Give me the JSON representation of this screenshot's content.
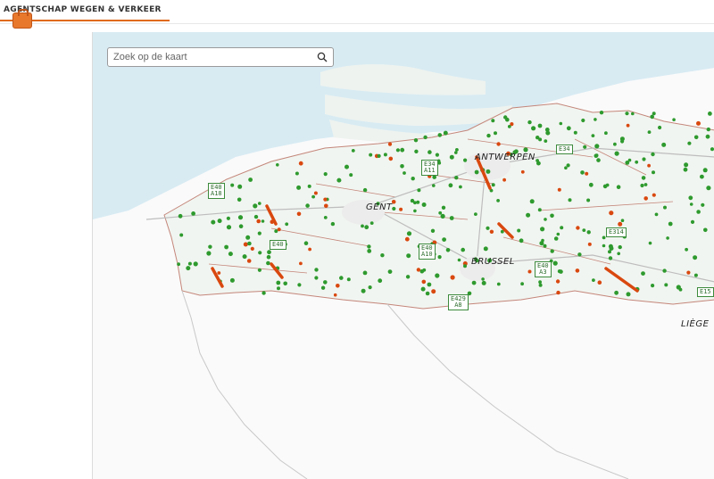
{
  "header": {
    "brand": "AGENTSCHAP WEGEN & VERKEER"
  },
  "search": {
    "placeholder": "Zoek op de kaart"
  },
  "map": {
    "cities": [
      "ANTWERPEN",
      "GENT",
      "BRUSSEL",
      "LIÈGE"
    ],
    "road_badges": [
      {
        "line1": "E40",
        "line2": "A18"
      },
      {
        "line1": "E34",
        "line2": "A11"
      },
      {
        "line1": "E34",
        "line2": ""
      },
      {
        "line1": "E40",
        "line2": "A10"
      },
      {
        "line1": "E40",
        "line2": ""
      },
      {
        "line1": "E314",
        "line2": ""
      },
      {
        "line1": "E40",
        "line2": "A3"
      },
      {
        "line1": "E429",
        "line2": "A8"
      },
      {
        "line1": "E15",
        "line2": ""
      }
    ],
    "colors": {
      "sea": "#d6eaf2",
      "land": "#f7f9f7",
      "border": "#c4867a",
      "marker_ok": "#2e9a2e",
      "marker_alert": "#d9480f"
    }
  }
}
